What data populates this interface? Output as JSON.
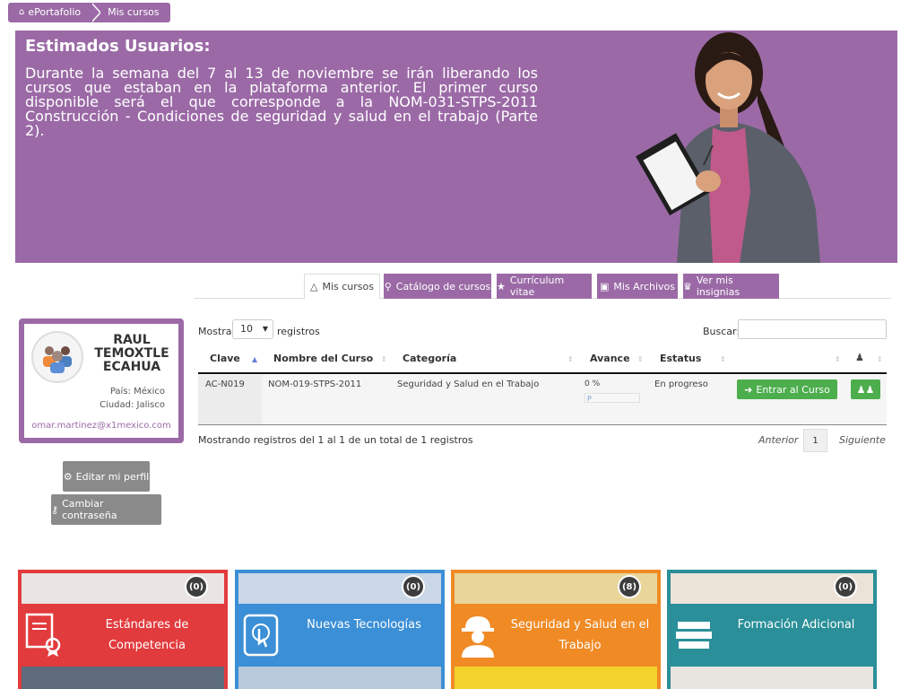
{
  "breadcrumb": {
    "home": "ePortafolio",
    "current": "Mis cursos"
  },
  "banner": {
    "title": "Estimados Usuarios:",
    "message": "Durante la semana del 7 al 13 de noviembre se irán liberando los cursos que estaban en la plataforma anterior. El primer curso disponible será el que corresponde a la NOM-031-STPS-2011 Construcción - Condiciones de seguridad y salud en el trabajo (Parte 2).",
    "color": "#9b6aa6"
  },
  "tabs": [
    {
      "label": "Mis cursos",
      "icon": "graduation-cap-icon"
    },
    {
      "label": "Catálogo de cursos",
      "icon": "search-icon"
    },
    {
      "label": "Currículum vitae",
      "icon": "star-icon"
    },
    {
      "label": "Mis Archivos",
      "icon": "archive-icon"
    },
    {
      "label": "Ver mis insignias",
      "icon": "trophy-icon"
    }
  ],
  "profile": {
    "name": "RAUL TEMOXTLE ECAHUA",
    "country_label": "País: México",
    "city_label": "Ciudad: Jalisco",
    "email": "omar.martinez@x1mexico.com"
  },
  "actions": {
    "edit_profile": "Editar mi perfil",
    "change_password": "Cambiar contraseña"
  },
  "table": {
    "show_label": "Mostrar",
    "show_value": "10",
    "records_label": "registros",
    "search_label": "Buscar:",
    "search_value": "",
    "columns": [
      "Clave",
      "Nombre del Curso",
      "Categoría",
      "Avance",
      "Estatus"
    ],
    "rows": [
      {
        "clave": "AC-N019",
        "nombre": "NOM-019-STPS-2011",
        "categoria": "Seguridad y Salud en el Trabajo",
        "avance": "0 %",
        "avance_fraction": 0,
        "avance_marker": "P",
        "estatus": "En progreso",
        "enter_label": "Entrar al Curso"
      }
    ],
    "info": "Mostrando registros del 1 al 1 de un total de 1 registros",
    "pagination": {
      "prev": "Anterior",
      "page": "1",
      "next": "Siguiente"
    }
  },
  "categories": [
    {
      "title": "Estándares de Competencia",
      "count": "(0)",
      "color": "#e23b3d",
      "icon": "certificate-icon"
    },
    {
      "title": "Nuevas Tecnologías",
      "count": "(0)",
      "color": "#3b8fd6",
      "icon": "touch-tablet-icon"
    },
    {
      "title": "Seguridad y Salud en el Trabajo",
      "count": "(8)",
      "color": "#f08a25",
      "icon": "worker-helmet-icon"
    },
    {
      "title": "Formación Adicional",
      "count": "(0)",
      "color": "#2a8f99",
      "icon": "books-icon"
    }
  ]
}
